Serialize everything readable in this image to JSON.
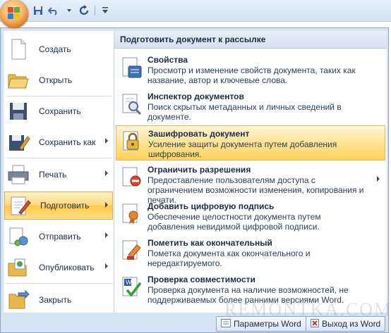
{
  "menu": {
    "left_items": [
      {
        "label": "Создать",
        "icon": "new-document-icon"
      },
      {
        "label": "Открыть",
        "icon": "open-folder-icon"
      },
      {
        "label": "Сохранить",
        "icon": "save-disk-icon"
      },
      {
        "label": "Сохранить как",
        "icon": "save-as-icon"
      },
      {
        "label": "Печать",
        "icon": "printer-icon"
      },
      {
        "label": "Подготовить",
        "icon": "prepare-icon"
      },
      {
        "label": "Отправить",
        "icon": "send-icon"
      },
      {
        "label": "Опубликовать",
        "icon": "publish-icon"
      },
      {
        "label": "Закрыть",
        "icon": "close-folder-icon"
      }
    ],
    "submenu_title": "Подготовить документ к рассылке",
    "submenu_items": [
      {
        "title": "Свойства",
        "desc": "Просмотр и изменение свойств документа, таких как название, автор и ключевые слова."
      },
      {
        "title": "Инспектор документов",
        "desc": "Поиск скрытых метаданных и личных сведений в документе."
      },
      {
        "title": "Зашифровать документ",
        "desc": "Усиление защиты документа путем добавления шифрования."
      },
      {
        "title": "Ограничить разрешения",
        "desc": "Предоставление пользователям доступа с ограничением возможности изменения, копирования и печати."
      },
      {
        "title": "Добавить цифровую подпись",
        "desc": "Обеспечение целостности документа путем добавления невидимой цифровой подписи."
      },
      {
        "title": "Пометить как окончательный",
        "desc": "Пометка документа как окончательного и нередактируемого."
      },
      {
        "title": "Проверка совместимости",
        "desc": "Проверка документа на наличие возможностей, не поддерживаемых более ранними версиями Word."
      }
    ],
    "footer": {
      "options_label": "Параметры Word",
      "exit_label": "Выход из Word"
    }
  },
  "watermark": "REMONTKA.COM"
}
